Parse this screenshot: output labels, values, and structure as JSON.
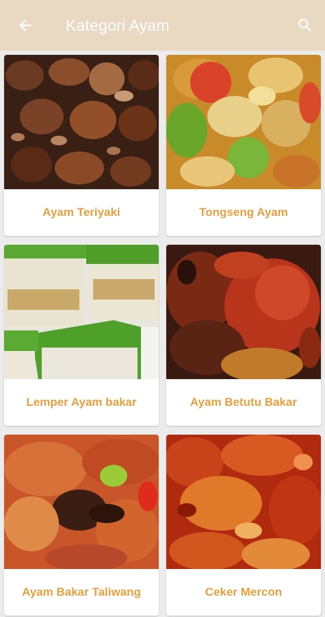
{
  "app_bar": {
    "title": "Kategori Ayam",
    "back_icon": "arrow-left-icon",
    "search_icon": "search-icon",
    "background_color": "#ead9c2"
  },
  "recipes": [
    {
      "name": "Ayam Teriyaki"
    },
    {
      "name": "Tongseng Ayam"
    },
    {
      "name": "Lemper Ayam bakar"
    },
    {
      "name": "Ayam Betutu Bakar"
    },
    {
      "name": "Ayam Bakar Taliwang"
    },
    {
      "name": "Ceker Mercon"
    }
  ],
  "colors": {
    "label_color": "#e8a03f",
    "card_background": "#ffffff",
    "page_background": "#ececec"
  }
}
